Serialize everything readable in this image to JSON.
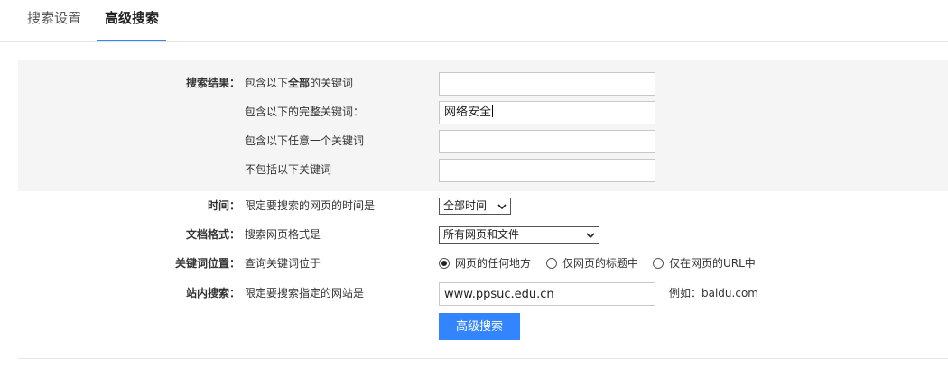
{
  "tabs": [
    {
      "label": "搜索设置"
    },
    {
      "label": "高级搜索"
    }
  ],
  "results": {
    "heading": "搜索结果：",
    "all_prefix": "包含以下",
    "all_bold": "全部",
    "all_suffix": "的关键词",
    "exact_label": "包含以下的完整关键词：",
    "any_label": "包含以下任意一个关键词",
    "none_label": "不包括以下关键词",
    "all_value": "",
    "exact_value": "网络安全",
    "any_value": "",
    "none_value": ""
  },
  "time": {
    "heading": "时间：",
    "label": "限定要搜索的网页的时间是",
    "selected": "全部时间"
  },
  "format": {
    "heading": "文档格式：",
    "label": "搜索网页格式是",
    "selected": "所有网页和文件"
  },
  "position": {
    "heading": "关键词位置：",
    "label": "查询关键词位于",
    "options": [
      "网页的任何地方",
      "仅网页的标题中",
      "仅在网页的URL中"
    ],
    "selected_index": 0
  },
  "site": {
    "heading": "站内搜索：",
    "label": "限定要搜索指定的网站是",
    "value": "www.ppsuc.edu.cn",
    "example": "例如：baidu.com"
  },
  "submit_label": "高级搜索",
  "colors": {
    "accent": "#3385ff",
    "panel": "#f5f5f5"
  }
}
